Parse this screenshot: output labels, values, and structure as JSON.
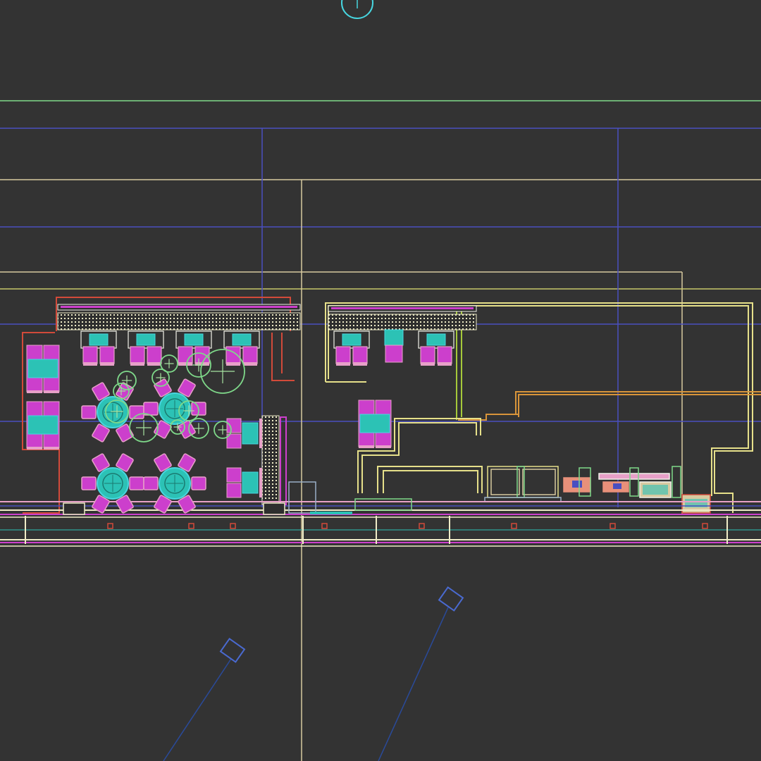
{
  "viewport": {
    "background": "#333333"
  },
  "palette": {
    "green": "#7fd98a",
    "mint": "#a6e3a1",
    "blue": "#4a4fc0",
    "navy": "#2a4a9a",
    "tan": "#d8c9a0",
    "yellow": "#e6e08a",
    "olive": "#c8c86a",
    "red": "#d24a3a",
    "orange": "#d8943a",
    "magenta": "#cc3fcc",
    "pink": "#e7a0c8",
    "teal": "#2cc2b5",
    "cyan": "#47d6e0",
    "cream": "#efecc8",
    "white": "#f2f2ea",
    "salmon": "#e8907a"
  },
  "icons": {
    "grid_bubble": "grid-bubble-icon",
    "section_marker": "section-marker-icon",
    "dining_table": "dining-table-icon",
    "booth_seat": "booth-seat-icon",
    "planter": "planter-icon"
  }
}
